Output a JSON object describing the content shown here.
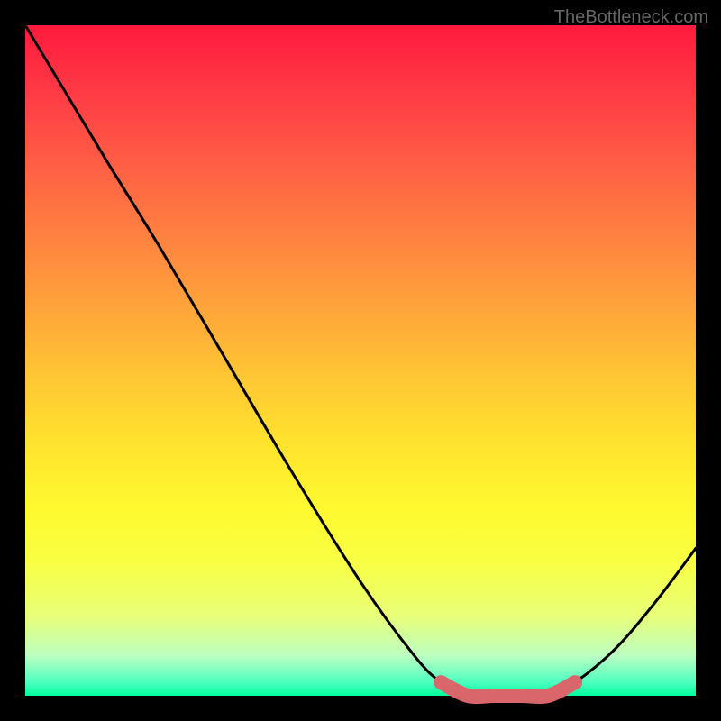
{
  "watermark": "TheBottleneck.com",
  "chart_data": {
    "type": "line",
    "title": "",
    "xlabel": "",
    "ylabel": "",
    "xlim": [
      0,
      1
    ],
    "ylim": [
      0,
      1
    ],
    "series": [
      {
        "name": "curve",
        "x": [
          0.0,
          0.06,
          0.12,
          0.2,
          0.3,
          0.4,
          0.5,
          0.58,
          0.62,
          0.66,
          0.7,
          0.74,
          0.78,
          0.82,
          0.88,
          0.94,
          1.0
        ],
        "y": [
          1.0,
          0.9,
          0.8,
          0.67,
          0.5,
          0.33,
          0.17,
          0.06,
          0.02,
          0.0,
          0.0,
          0.0,
          0.0,
          0.02,
          0.07,
          0.14,
          0.22
        ]
      },
      {
        "name": "highlight-segment",
        "x": [
          0.62,
          0.66,
          0.7,
          0.74,
          0.78,
          0.82
        ],
        "y": [
          0.02,
          0.0,
          0.0,
          0.0,
          0.0,
          0.02
        ]
      }
    ],
    "colors": {
      "curve": "#000000",
      "highlight": "#d9666a"
    }
  }
}
